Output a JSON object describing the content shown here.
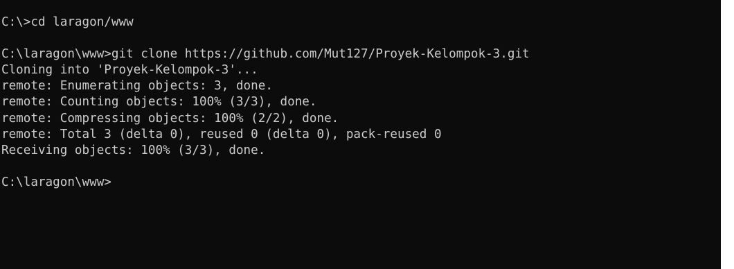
{
  "terminal": {
    "lines": [
      "C:\\>cd laragon/www",
      "",
      "C:\\laragon\\www>git clone https://github.com/Mut127/Proyek-Kelompok-3.git",
      "Cloning into 'Proyek-Kelompok-3'...",
      "remote: Enumerating objects: 3, done.",
      "remote: Counting objects: 100% (3/3), done.",
      "remote: Compressing objects: 100% (2/2), done.",
      "remote: Total 3 (delta 0), reused 0 (delta 0), pack-reused 0",
      "Receiving objects: 100% (3/3), done.",
      "",
      "C:\\laragon\\www>"
    ]
  },
  "colors": {
    "background": "#0c0c0c",
    "text": "#cccccc"
  }
}
